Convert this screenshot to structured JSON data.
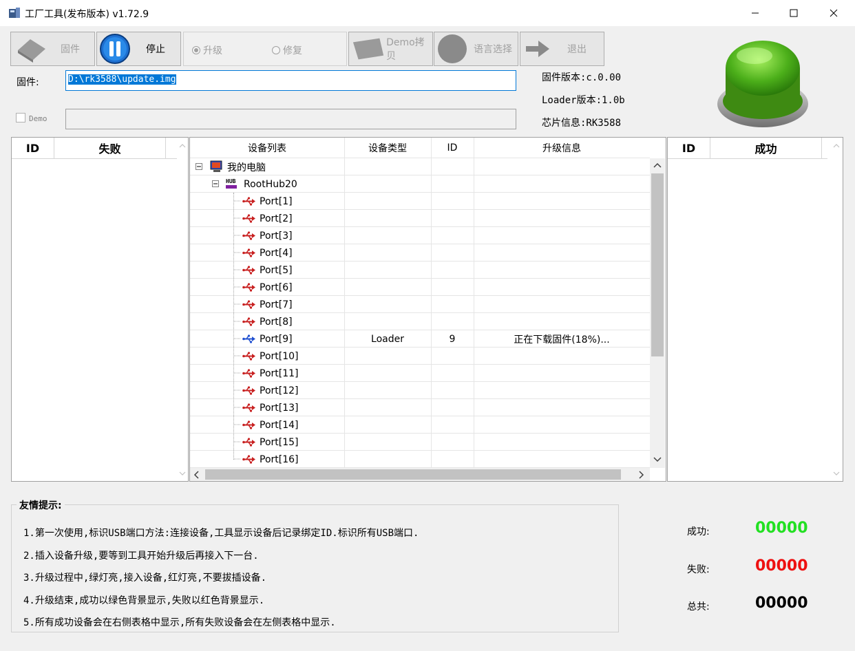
{
  "window": {
    "title": "工厂工具(发布版本) v1.72.9"
  },
  "toolbar": {
    "firmware_label": "固件",
    "stop_label": "停止",
    "upgrade_label": "升级",
    "repair_label": "修复",
    "demo_copy_label": "Demo拷贝",
    "language_label": "语言选择",
    "exit_label": "退出"
  },
  "firmware": {
    "label": "固件:",
    "path": "D:\\rk3588\\update.img"
  },
  "demo": {
    "label": "Demo",
    "path": ""
  },
  "info": {
    "firmware_version": "固件版本:c.0.00",
    "loader_version": "Loader版本:1.0b",
    "chip_info": "芯片信息:RK3588"
  },
  "status_light": {
    "color": "#4caf1a"
  },
  "fail_table": {
    "headers": [
      "ID",
      "失败"
    ]
  },
  "success_table": {
    "headers": [
      "ID",
      "成功"
    ]
  },
  "device_table": {
    "headers": [
      "设备列表",
      "设备类型",
      "ID",
      "升级信息"
    ],
    "root": "我的电脑",
    "hub": "RootHub20",
    "rows": [
      {
        "port": "Port[1]",
        "type": "",
        "id": "",
        "info": "",
        "icon": "red-usb"
      },
      {
        "port": "Port[2]",
        "type": "",
        "id": "",
        "info": "",
        "icon": "red-usb"
      },
      {
        "port": "Port[3]",
        "type": "",
        "id": "",
        "info": "",
        "icon": "red-usb"
      },
      {
        "port": "Port[4]",
        "type": "",
        "id": "",
        "info": "",
        "icon": "red-usb"
      },
      {
        "port": "Port[5]",
        "type": "",
        "id": "",
        "info": "",
        "icon": "red-usb"
      },
      {
        "port": "Port[6]",
        "type": "",
        "id": "",
        "info": "",
        "icon": "red-usb"
      },
      {
        "port": "Port[7]",
        "type": "",
        "id": "",
        "info": "",
        "icon": "red-usb"
      },
      {
        "port": "Port[8]",
        "type": "",
        "id": "",
        "info": "",
        "icon": "red-usb"
      },
      {
        "port": "Port[9]",
        "type": "Loader",
        "id": "9",
        "info": "正在下载固件(18%)...",
        "icon": "blue-usb"
      },
      {
        "port": "Port[10]",
        "type": "",
        "id": "",
        "info": "",
        "icon": "red-usb"
      },
      {
        "port": "Port[11]",
        "type": "",
        "id": "",
        "info": "",
        "icon": "red-usb"
      },
      {
        "port": "Port[12]",
        "type": "",
        "id": "",
        "info": "",
        "icon": "red-usb"
      },
      {
        "port": "Port[13]",
        "type": "",
        "id": "",
        "info": "",
        "icon": "red-usb"
      },
      {
        "port": "Port[14]",
        "type": "",
        "id": "",
        "info": "",
        "icon": "red-usb"
      },
      {
        "port": "Port[15]",
        "type": "",
        "id": "",
        "info": "",
        "icon": "red-usb"
      },
      {
        "port": "Port[16]",
        "type": "",
        "id": "",
        "info": "",
        "icon": "red-usb"
      }
    ]
  },
  "tips": {
    "title": "友情提示:",
    "lines": [
      "1.第一次使用,标识USB端口方法:连接设备,工具显示设备后记录绑定ID.标识所有USB端口.",
      "2.插入设备升级,要等到工具开始升级后再接入下一台.",
      "3.升级过程中,绿灯亮,接入设备,红灯亮,不要拔插设备.",
      "4.升级结束,成功以绿色背景显示,失败以红色背景显示.",
      "5.所有成功设备会在右侧表格中显示,所有失败设备会在左侧表格中显示."
    ]
  },
  "stats": {
    "success_label": "成功:",
    "success_value": "00000",
    "success_color": "#22e022",
    "fail_label": "失败:",
    "fail_value": "00000",
    "fail_color": "#ee1111",
    "total_label": "总共:",
    "total_value": "00000"
  }
}
